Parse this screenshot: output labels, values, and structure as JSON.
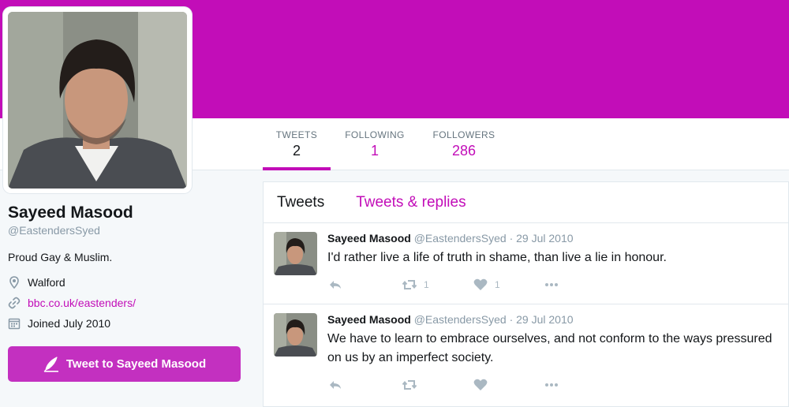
{
  "profile": {
    "name": "Sayeed Masood",
    "handle": "@EastendersSyed",
    "bio": "Proud Gay & Muslim.",
    "location": "Walford",
    "website": "bbc.co.uk/eastenders/",
    "joined": "Joined July 2010",
    "tweet_to_label": "Tweet to Sayeed Masood"
  },
  "nav": {
    "tweets_label": "TWEETS",
    "tweets_count": "2",
    "following_label": "FOLLOWING",
    "following_count": "1",
    "followers_label": "FOLLOWERS",
    "followers_count": "286"
  },
  "tabs": {
    "tweets": "Tweets",
    "tweets_replies": "Tweets & replies"
  },
  "tweets": [
    {
      "author": "Sayeed Masood",
      "handle": "@EastendersSyed",
      "separator": "·",
      "date": "29 Jul 2010",
      "text": "I'd rather live a life of truth in shame, than live a lie in honour.",
      "retweets": "1",
      "likes": "1"
    },
    {
      "author": "Sayeed Masood",
      "handle": "@EastendersSyed",
      "separator": "·",
      "date": "29 Jul 2010",
      "text": "We have to learn to embrace ourselves, and not conform to the ways pressured on us by an imperfect society.",
      "retweets": "",
      "likes": ""
    }
  ],
  "colors": {
    "brand": "#c20db8",
    "button": "#c330c0",
    "muted": "#8899a6"
  }
}
